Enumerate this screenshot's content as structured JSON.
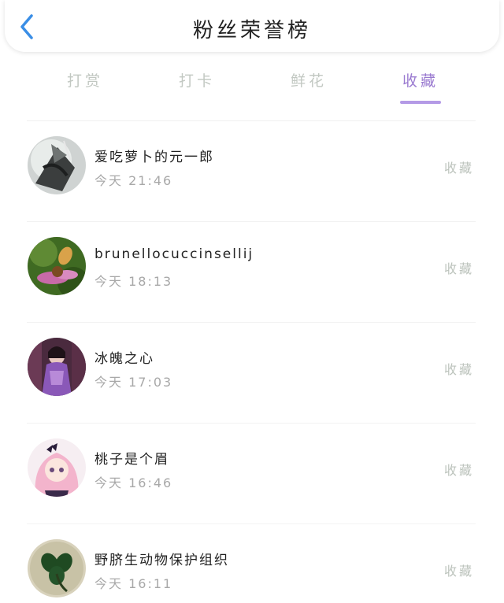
{
  "header": {
    "title": "粉丝荣誉榜",
    "back_icon": "chevron-left-icon",
    "back_color": "#3a8ee6"
  },
  "tabs": [
    {
      "label": "打赏",
      "active": false
    },
    {
      "label": "打卡",
      "active": false
    },
    {
      "label": "鲜花",
      "active": false
    },
    {
      "label": "收藏",
      "active": true
    }
  ],
  "colors": {
    "active_tab": "#9a7ad0",
    "tab_underline": "#b49ae6",
    "inactive_tab": "#c2c8c2"
  },
  "list": {
    "items": [
      {
        "name": "爱吃萝卜的元一郎",
        "time": "今天 21:46",
        "action": "收藏"
      },
      {
        "name": "brunellocuccinsellij",
        "time": "今天 18:13",
        "action": "收藏"
      },
      {
        "name": "冰魄之心",
        "time": "今天 17:03",
        "action": "收藏"
      },
      {
        "name": "桃子是个眉",
        "time": "今天 16:46",
        "action": "收藏"
      },
      {
        "name": "野脐生动物保护组织",
        "time": "今天 16:11",
        "action": "收藏"
      }
    ]
  }
}
